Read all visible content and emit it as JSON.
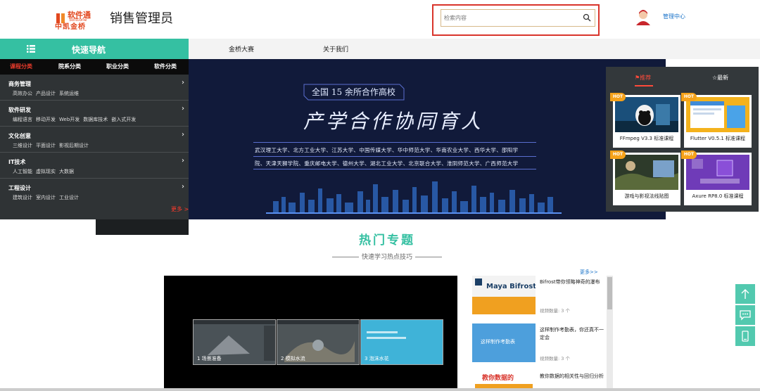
{
  "header": {
    "logo_cn": "软件通",
    "logo_en": "Softtone",
    "logo_brand": "中凯金桥",
    "title": "销售管理员",
    "search_placeholder": "检索内容",
    "admin_link": "管理中心"
  },
  "nav": {
    "quick_nav_label": "快速导航",
    "links": [
      "金桥大赛",
      "关于我们"
    ]
  },
  "sidebar": {
    "tabs": [
      "课程分类",
      "院系分类",
      "职业分类",
      "软件分类"
    ],
    "categories": [
      {
        "title": "商务管理",
        "items": [
          "高效办公",
          "产品设计",
          "系统运维"
        ]
      },
      {
        "title": "软件研发",
        "items": [
          "编程语言",
          "移动开发",
          "Web开发",
          "数据库技术",
          "嵌入式开发"
        ]
      },
      {
        "title": "文化创意",
        "items": [
          "三维设计",
          "平面设计",
          "影视后期设计"
        ]
      },
      {
        "title": "IT技术",
        "items": [
          "人工智能",
          "虚拟现实",
          "大数据"
        ]
      },
      {
        "title": "工程设计",
        "items": [
          "建筑设计",
          "室内设计",
          "工业设计"
        ]
      }
    ],
    "more": "更多 >"
  },
  "banner": {
    "subtitle": "全国 15 余所合作高校",
    "title": "产学合作协同育人",
    "line1": "武汉理工大学、北方工业大学、江苏大学、中国传媒大学、华中师范大学、华南农业大学、西华大学、邵阳学",
    "line2": "院、天津天狮学院、重庆邮电大学、德州大学、湖北工业大学、北京联合大学、淮阴师范大学、广西师范大学"
  },
  "courses": {
    "tabs": [
      "推荐",
      "最新"
    ],
    "hot_label": "HOT",
    "items": [
      {
        "name": "FFmpeg V3.3 标准课程"
      },
      {
        "name": "Flutter V0.5.1 标准课程"
      },
      {
        "name": "游戏与影视法线贴图"
      },
      {
        "name": "Axure RP8.0 标准课程"
      }
    ]
  },
  "hot_topics": {
    "title": "热门专题",
    "subtitle": "快速学习热点技巧",
    "more": "更多>>",
    "player_thumbs": [
      "1 场景准备",
      "2 模拟水流",
      "3 泡沫水花"
    ],
    "videos": [
      {
        "title": "Bifrost带你领略神奇的瀑布",
        "count": "视频数量: 3 个",
        "thumb_text": "Maya Bifrost"
      },
      {
        "title": "这样制作考勤表，你还真不一定会",
        "count": "视频数量: 3 个",
        "thumb_text": "这样制作考勤表"
      },
      {
        "title": "教你数据的相关性与回归分析",
        "count": "",
        "thumb_text": "教你数据的"
      }
    ]
  },
  "colors": {
    "accent": "#35c0a2",
    "highlight": "#d9342b",
    "banner_bg": "#111a3a"
  }
}
